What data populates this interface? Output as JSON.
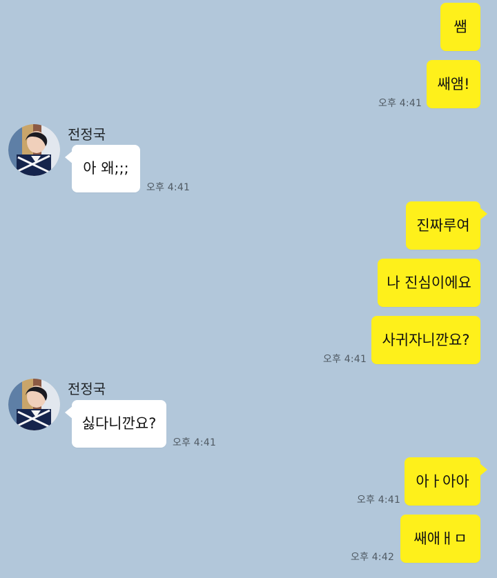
{
  "chat": {
    "background_color": "#b2c7da",
    "outgoing_color": "#fef01b",
    "incoming_color": "#ffffff",
    "messages": [
      {
        "type": "out",
        "text": "쌤",
        "time": ""
      },
      {
        "type": "out",
        "text": "쌔앰!",
        "time": "오후 4:41"
      },
      {
        "type": "in",
        "sender": "전정국",
        "text": "아 왜;;;",
        "time": "오후 4:41"
      },
      {
        "type": "out",
        "text": "진짜루여",
        "time": ""
      },
      {
        "type": "out",
        "text": "나 진심이에요",
        "time": ""
      },
      {
        "type": "out",
        "text": "사귀자니깐요?",
        "time": "오후 4:41"
      },
      {
        "type": "in",
        "sender": "전정국",
        "text": "싫다니깐요?",
        "time": "오후 4:41"
      },
      {
        "type": "out",
        "text": "아ㅏ아아",
        "time": "오후 4:41"
      },
      {
        "type": "out",
        "text": "쌔애ㅐㅁ",
        "time": "오후 4:42"
      }
    ]
  }
}
